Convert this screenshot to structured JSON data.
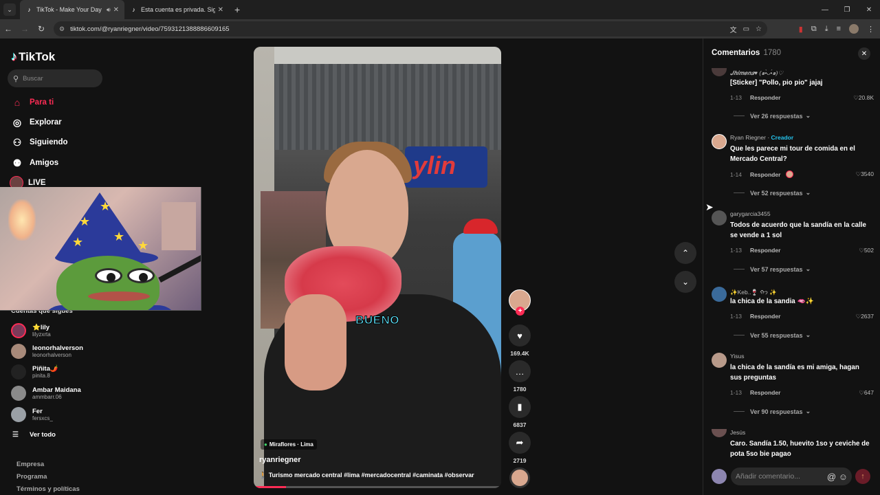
{
  "browser": {
    "tabs": [
      {
        "title": "TikTok - Make Your Day",
        "active": true
      },
      {
        "title": "Esta cuenta es privada. Sigue e…",
        "active": false
      }
    ],
    "url": "tiktok.com/@ryanriegner/video/7593121388886609165"
  },
  "sidebar": {
    "brand": "TikTok",
    "search_placeholder": "Buscar",
    "nav": [
      {
        "label": "Para ti",
        "icon": "home-icon",
        "active": true
      },
      {
        "label": "Explorar",
        "icon": "compass-icon"
      },
      {
        "label": "Siguiendo",
        "icon": "following-icon"
      },
      {
        "label": "Amigos",
        "icon": "friends-icon"
      },
      {
        "label": "LIVE",
        "icon": "live-icon"
      }
    ],
    "following_heading": "Cuentas que sigues",
    "accounts": [
      {
        "name": "⭐lily",
        "handle": "lilyzxrta"
      },
      {
        "name": "leonorhalverson",
        "handle": "leonorhalverson"
      },
      {
        "name": "Piñita🌶️",
        "handle": "pinita.8"
      },
      {
        "name": "Ambar Maidana",
        "handle": "ammbarr.06"
      },
      {
        "name": "Fer",
        "handle": "fersxcs_"
      }
    ],
    "see_all": "Ver todo",
    "footer": [
      "Empresa",
      "Programa",
      "Términos y políticas"
    ]
  },
  "video": {
    "caption_word": "BUENO",
    "location": "Miraflores · Lima",
    "author": "ryanriegner",
    "description": "🚶 Turismo mercado central #lima #mercadocentral #caminata #observar",
    "sign_text": "ylin",
    "progress": 0.13
  },
  "actions": {
    "likes": "169.4K",
    "comments": "1780",
    "saves": "6837",
    "shares": "2719"
  },
  "comments": {
    "title": "Comentarios",
    "count": "1780",
    "input_placeholder": "Añadir comentario...",
    "reply_label": "Responder",
    "creator_label": "Creador",
    "items": [
      {
        "name": "𝑱𝒉𝒊𝒎𝒆𝒏𝒂♥ (๑•̀ᴗ•́๑)♡",
        "text": "[Sticker] \"Pollo, pio pio\" jajaj",
        "date": "1-13",
        "likes": "20.8K",
        "more": "Ver 26 respuestas"
      },
      {
        "name": "Ryan Riegner",
        "text": "Que les parece mi tour de comida en el Mercado Central?",
        "date": "1-14",
        "likes": "3540",
        "more": "Ver 52 respuestas",
        "creator": true
      },
      {
        "name": "garygarcia3455",
        "text": "Todos de acuerdo que la sandía en la calle se vende a 1 sol",
        "date": "1-13",
        "likes": "502",
        "more": "Ver 57 respuestas"
      },
      {
        "name": "✨Keb..🍷 ᡣ𐭩 ✨",
        "text": "la chica de la sandia 🫦✨",
        "date": "1-13",
        "likes": "2637",
        "more": "Ver 55 respuestas"
      },
      {
        "name": "Yisus",
        "text": "la chica de la sandía es mi amiga, hagan sus preguntas",
        "date": "1-13",
        "likes": "647",
        "more": "Ver 90 respuestas"
      },
      {
        "name": "Jesús",
        "text": "Caro. Sandía 1.50, huevito 1so y ceviche de pota 5so bie pagao"
      }
    ]
  }
}
